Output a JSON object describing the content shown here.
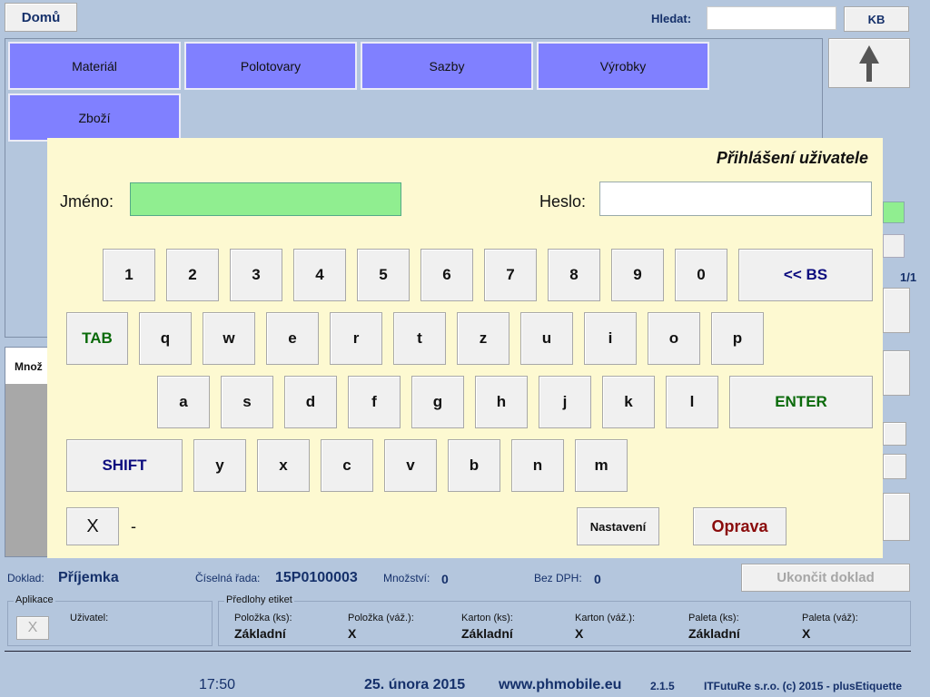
{
  "header": {
    "home_label": "Domů",
    "search_label": "Hledat:",
    "search_value": "",
    "kb_label": "KB"
  },
  "categories": [
    "Materiál",
    "Polotovary",
    "Sazby",
    "Výrobky",
    "Zboží"
  ],
  "right_panel": {
    "page_indicator": "1/1"
  },
  "left_panel": {
    "partial_label": "Množ"
  },
  "dialog": {
    "title": "Přihlášení uživatele",
    "name_label": "Jméno:",
    "name_value": "",
    "password_label": "Heslo:",
    "password_value": "",
    "keys_row1": [
      "1",
      "2",
      "3",
      "4",
      "5",
      "6",
      "7",
      "8",
      "9",
      "0"
    ],
    "backspace_label": "<< BS",
    "tab_label": "TAB",
    "keys_row2": [
      "q",
      "w",
      "e",
      "r",
      "t",
      "z",
      "u",
      "i",
      "o",
      "p"
    ],
    "keys_row3": [
      "a",
      "s",
      "d",
      "f",
      "g",
      "h",
      "j",
      "k",
      "l"
    ],
    "enter_label": "ENTER",
    "shift_label": "SHIFT",
    "keys_row4": [
      "y",
      "x",
      "c",
      "v",
      "b",
      "n",
      "m"
    ],
    "close_label": "X",
    "dash_label": "-",
    "settings_label": "Nastavení",
    "fix_label": "Oprava"
  },
  "document": {
    "doc_label": "Doklad:",
    "doc_value": "Příjemka",
    "series_label": "Číselná řada:",
    "series_value": "15P0100003",
    "qty_label": "Množství:",
    "qty_value": "0",
    "nodph_label": "Bez DPH:",
    "nodph_value": "0",
    "finish_label": "Ukončit doklad"
  },
  "app_group": {
    "title": "Aplikace",
    "x_label": "X",
    "user_label": "Uživatel:",
    "user_value": ""
  },
  "labels_group": {
    "title": "Předlohy etiket",
    "items": [
      {
        "label": "Položka (ks):",
        "value": "Základní"
      },
      {
        "label": "Položka (váž.):",
        "value": "X"
      },
      {
        "label": "Karton (ks):",
        "value": "Základní"
      },
      {
        "label": "Karton (váž.):",
        "value": "X"
      },
      {
        "label": "Paleta (ks):",
        "value": "Základní"
      },
      {
        "label": "Paleta (váž):",
        "value": "X"
      }
    ]
  },
  "footer": {
    "time": "17:50",
    "date": "25. února 2015",
    "website": "www.phmobile.eu",
    "version": "2.1.5",
    "copyright": "ITFutuRe s.r.o. (c) 2015 - plusEtiquette"
  },
  "colors": {
    "background": "#b4c6dd",
    "category": "#8080ff",
    "dialog": "#fdf9d1",
    "name_field": "#90ee90"
  }
}
